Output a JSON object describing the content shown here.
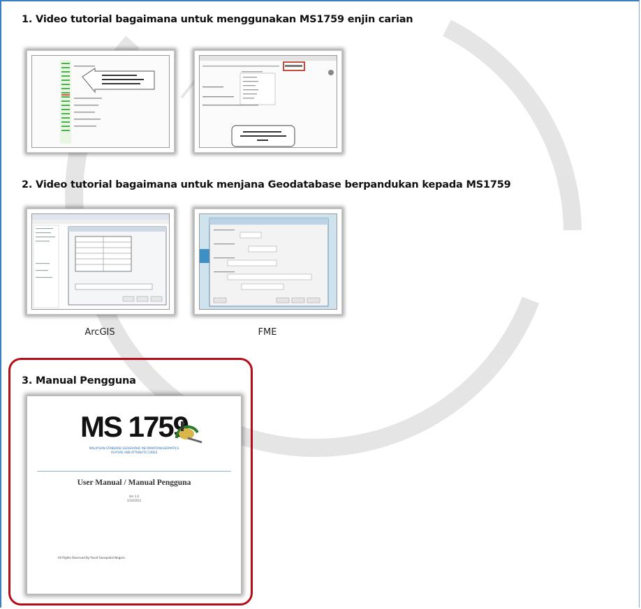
{
  "sections": [
    {
      "title": "1. Video tutorial bagaimana untuk menggunakan MS1759 enjin carian"
    },
    {
      "title": "2. Video tutorial bagaimana untuk menjana Geodatabase berpandukan kepada MS1759"
    },
    {
      "title": "3. Manual Pengguna"
    }
  ],
  "videos2": [
    {
      "caption": "ArcGIS"
    },
    {
      "caption": "FME"
    }
  ],
  "manual": {
    "logo": "MS 1759",
    "subtitle1": "MALAYSIAN STANDARD GEOGRAPHIC INFORMATION/GEOMATICS",
    "subtitle2": "FEATURE AND ATTRIBUTE CODES",
    "heading": "User Manual / Manual Pengguna",
    "version": "Ver 1.0",
    "date": "1/10/2011",
    "footer": "All Rights Reserved By Pusat Geospatial Negara"
  },
  "colors": {
    "frame_border": "#3a7fc0",
    "highlight_border": "#b40d18",
    "watermark": "#c9c9c9"
  }
}
